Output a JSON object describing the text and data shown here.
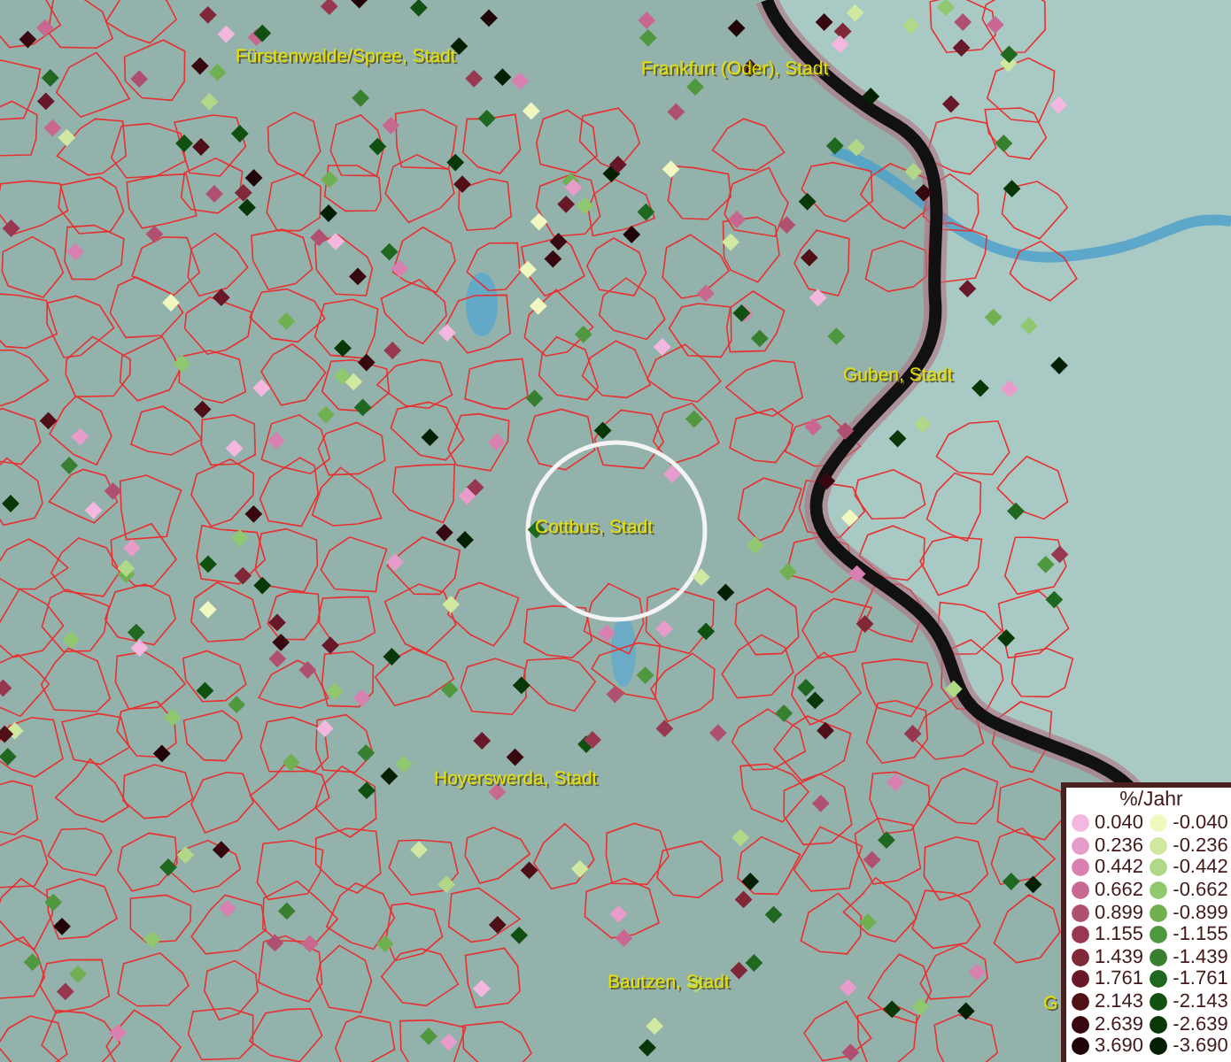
{
  "map": {
    "labels": [
      {
        "text": "Fürstenwalde/Spree, Stadt"
      },
      {
        "text": "Frankfurt (Oder), Stadt"
      },
      {
        "text": "Guben, Stadt"
      },
      {
        "text": "Cottbus, Stadt"
      },
      {
        "text": "Hoyerswerda, Stadt"
      },
      {
        "text": "Bautzen, Stadt"
      },
      {
        "text": "G"
      }
    ]
  },
  "legend": {
    "title": "%/Jahr",
    "positive": [
      {
        "value": "0.040",
        "color": "#f4b8e0"
      },
      {
        "value": "0.236",
        "color": "#e89ccb"
      },
      {
        "value": "0.442",
        "color": "#d880b0"
      },
      {
        "value": "0.662",
        "color": "#c86890"
      },
      {
        "value": "0.899",
        "color": "#b05070"
      },
      {
        "value": "1.155",
        "color": "#983850"
      },
      {
        "value": "1.439",
        "color": "#802838"
      },
      {
        "value": "1.761",
        "color": "#681828"
      },
      {
        "value": "2.143",
        "color": "#501018"
      },
      {
        "value": "2.639",
        "color": "#380810"
      },
      {
        "value": "3.690",
        "color": "#200408"
      }
    ],
    "negative": [
      {
        "value": "-0.040",
        "color": "#f0f8c0"
      },
      {
        "value": "-0.236",
        "color": "#d0e8a0"
      },
      {
        "value": "-0.442",
        "color": "#b0d888"
      },
      {
        "value": "-0.662",
        "color": "#90c870"
      },
      {
        "value": "-0.899",
        "color": "#70b050"
      },
      {
        "value": "-1.155",
        "color": "#509840"
      },
      {
        "value": "-1.439",
        "color": "#388030"
      },
      {
        "value": "-1.761",
        "color": "#206820"
      },
      {
        "value": "-2.143",
        "color": "#105010"
      },
      {
        "value": "-2.639",
        "color": "#083808"
      },
      {
        "value": "-3.690",
        "color": "#042004"
      }
    ]
  }
}
